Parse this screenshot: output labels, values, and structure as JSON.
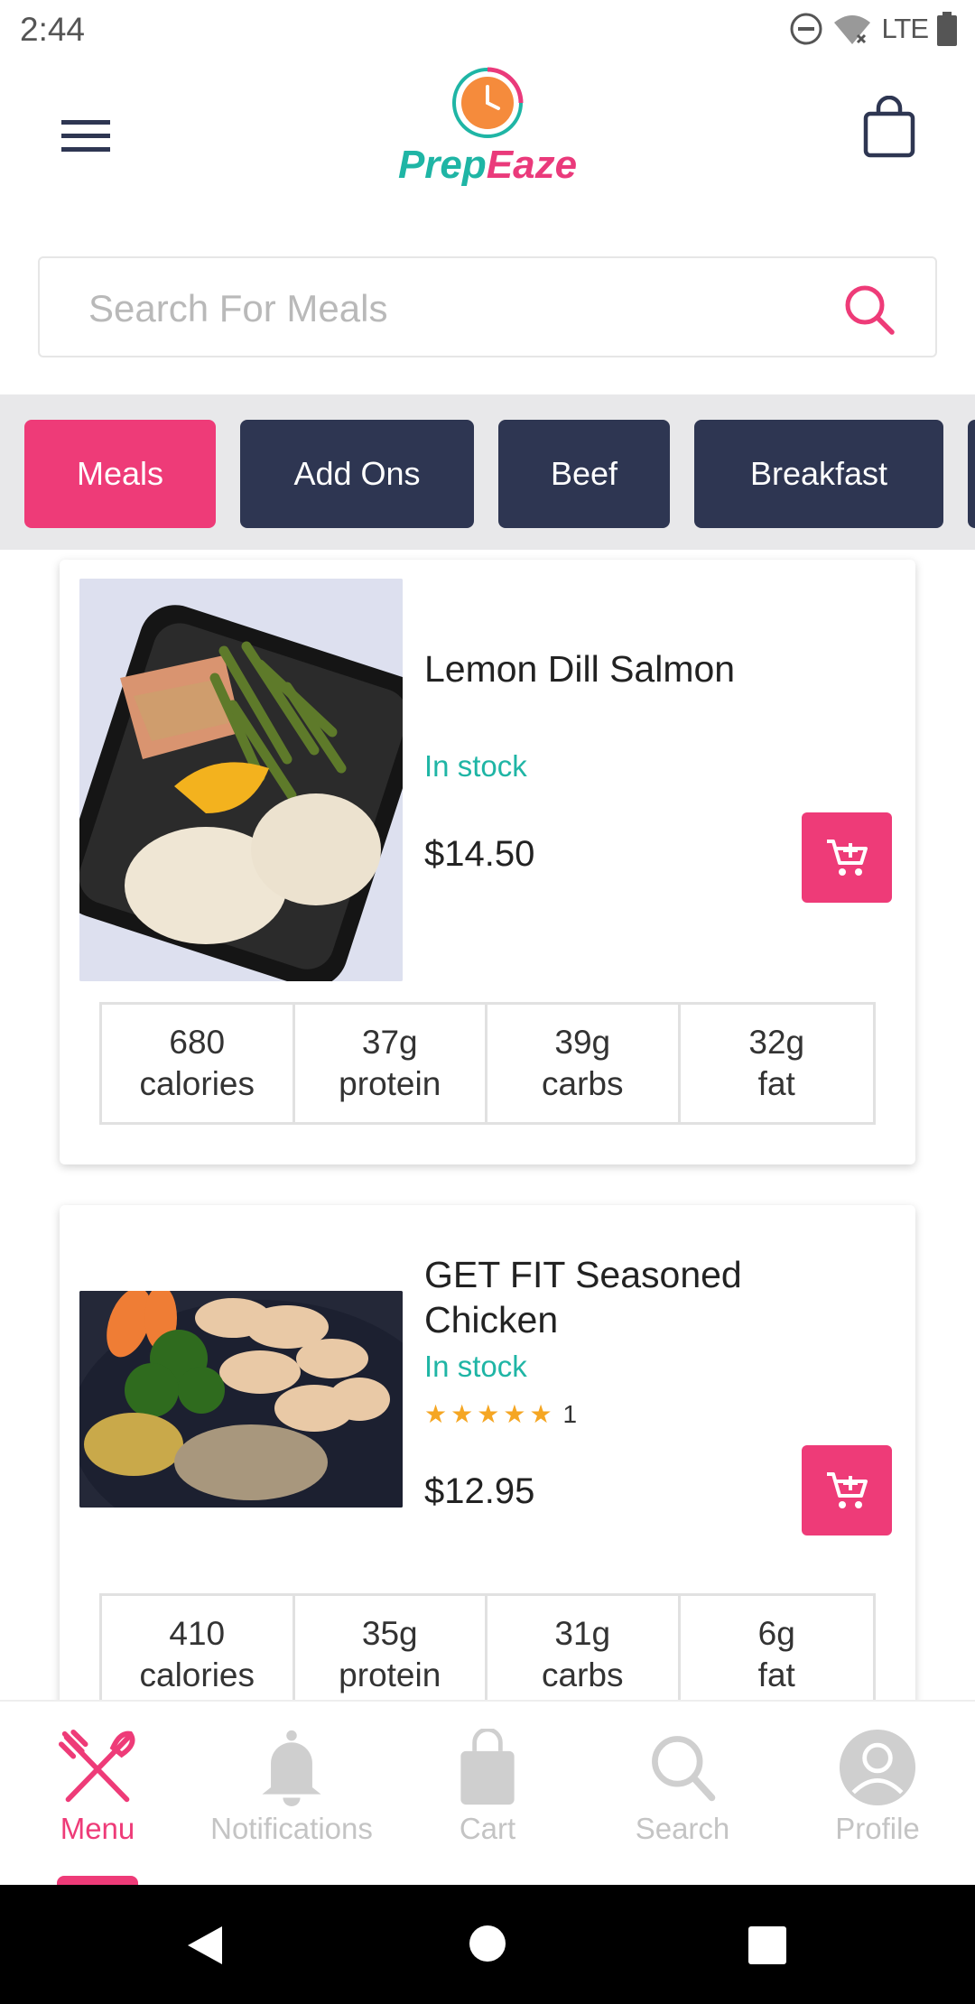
{
  "status_bar": {
    "time": "2:44",
    "network": "LTE"
  },
  "header": {
    "logo_prep": "Prep",
    "logo_eaze": "Eaze"
  },
  "search": {
    "placeholder": "Search For Meals"
  },
  "tabs": [
    {
      "label": "Meals",
      "active": true
    },
    {
      "label": "Add Ons",
      "active": false
    },
    {
      "label": "Beef",
      "active": false
    },
    {
      "label": "Breakfast",
      "active": false
    }
  ],
  "products": [
    {
      "name": "Lemon Dill Salmon",
      "stock": "In stock",
      "price": "$14.50",
      "nutrition": [
        {
          "value": "680",
          "unit": "calories"
        },
        {
          "value": "37g",
          "unit": "protein"
        },
        {
          "value": "39g",
          "unit": "carbs"
        },
        {
          "value": "32g",
          "unit": "fat"
        }
      ]
    },
    {
      "name_line1": "GET FIT Seasoned",
      "name_line2": "Chicken",
      "stock": "In stock",
      "rating_count": "1",
      "rating_stars": 5,
      "price": "$12.95",
      "nutrition": [
        {
          "value": "410",
          "unit": "calories"
        },
        {
          "value": "35g",
          "unit": "protein"
        },
        {
          "value": "31g",
          "unit": "carbs"
        },
        {
          "value": "6g",
          "unit": "fat"
        }
      ]
    }
  ],
  "bottom_nav": [
    {
      "label": "Menu",
      "icon": "fork-knife-icon",
      "active": true
    },
    {
      "label": "Notifications",
      "icon": "bell-icon",
      "active": false
    },
    {
      "label": "Cart",
      "icon": "shopping-bag-icon",
      "active": false
    },
    {
      "label": "Search",
      "icon": "search-icon",
      "active": false
    },
    {
      "label": "Profile",
      "icon": "profile-icon",
      "active": false
    }
  ],
  "colors": {
    "accent": "#ee3b78",
    "teal": "#1fb5a5",
    "tab_dark": "#2e3652"
  }
}
